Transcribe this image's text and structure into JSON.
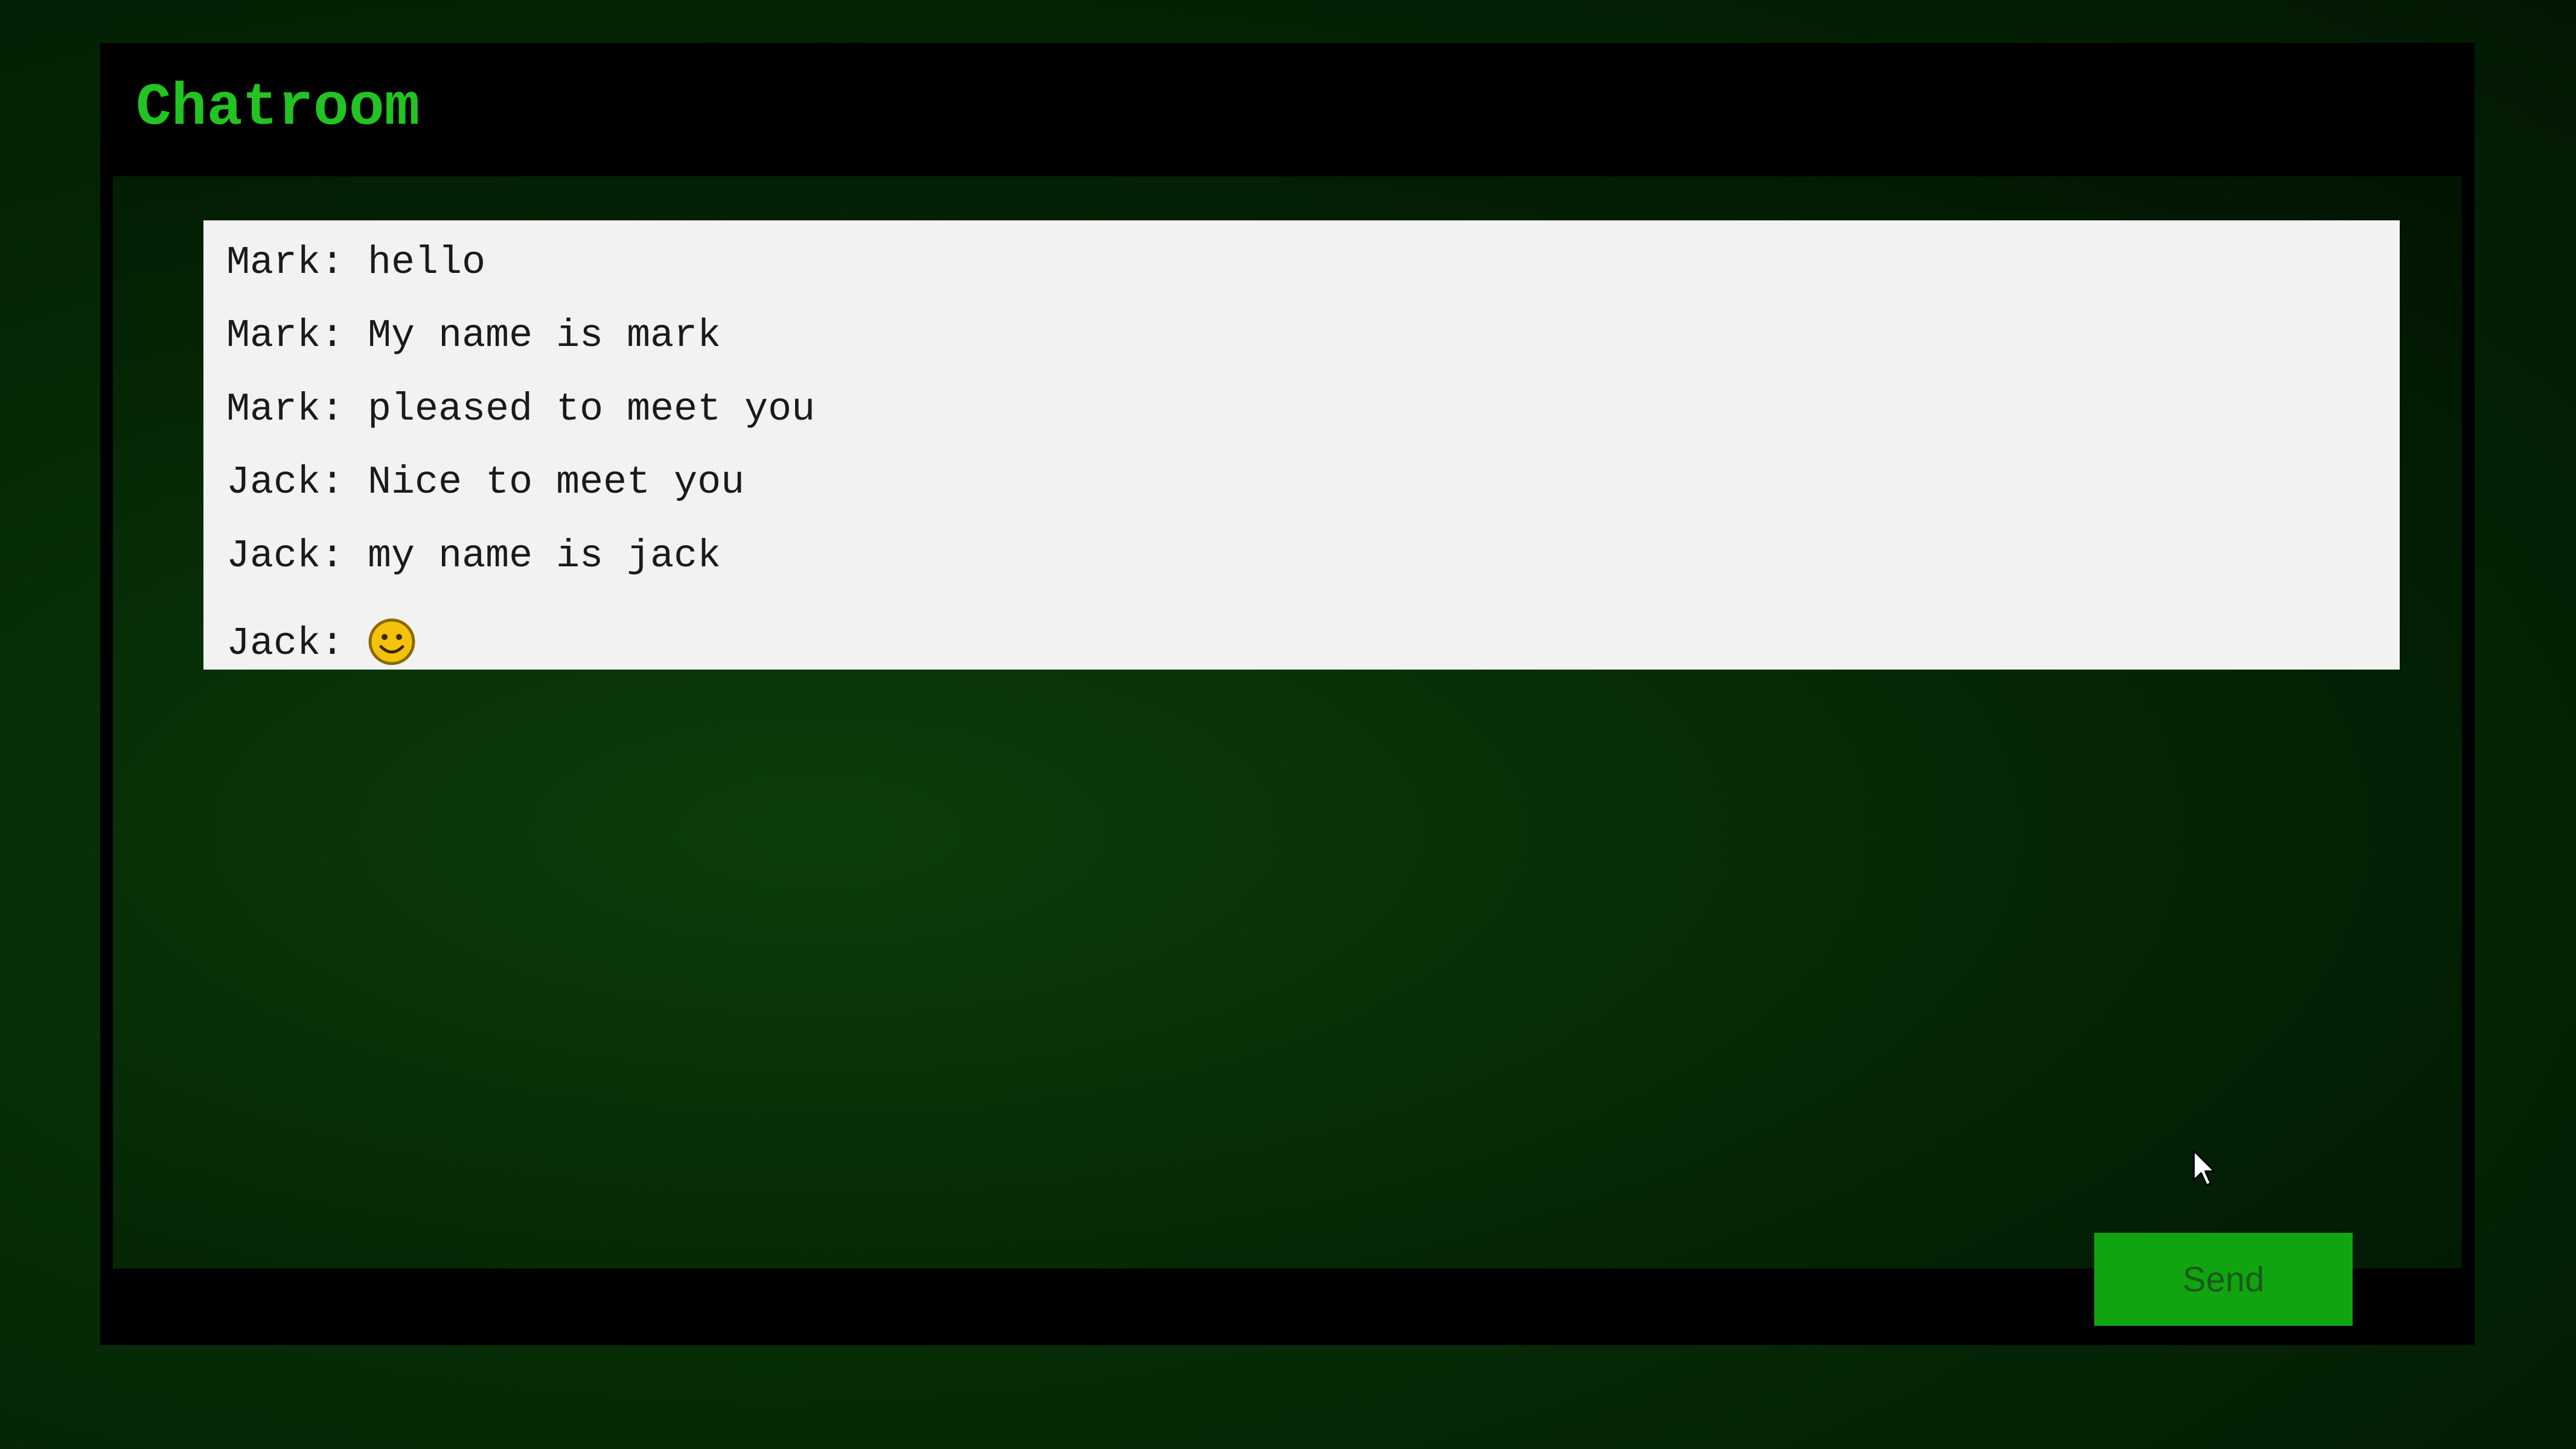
{
  "app": {
    "title": "Chatroom"
  },
  "messages": [
    {
      "sender": "Mark",
      "text": "hello"
    },
    {
      "sender": "Mark",
      "text": "My name is mark"
    },
    {
      "sender": "Mark",
      "text": "pleased to meet you"
    },
    {
      "sender": "Jack",
      "text": "Nice to meet you"
    },
    {
      "sender": "Jack",
      "text": "my name is jack"
    },
    {
      "sender": "Jack",
      "text": "",
      "icon": "smiley-face-icon"
    }
  ],
  "composer": {
    "value": "",
    "send_label": "Send"
  },
  "colors": {
    "title": "#22c322",
    "send_button": "#10a510",
    "message_panel": "#f2f2f2"
  }
}
